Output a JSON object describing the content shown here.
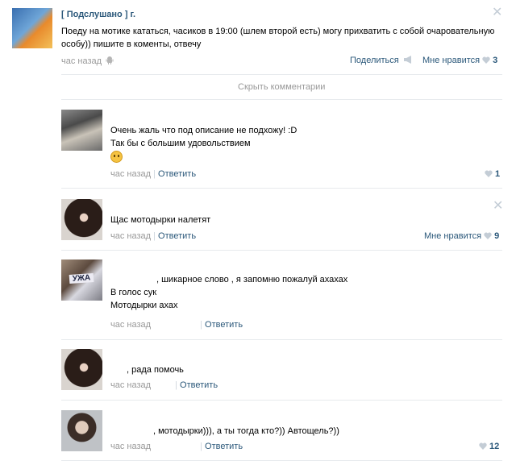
{
  "post": {
    "author": "[ Подслушано ] г.",
    "text": "Поеду на мотике кататься, часиков в 19:00 (шлем второй есть) могу прихватить с собой очаровательную особу)) пишите в коменты, отвечу",
    "time": "час назад",
    "share_label": "Поделиться",
    "like_label": "Мне нравится",
    "like_count": "3"
  },
  "hide_comments_label": "Скрыть комментарии",
  "comments": [
    {
      "lines": [
        "Очень жаль что под описание не подхожу! :D",
        "Так бы с большим удовольствием"
      ],
      "time": "час назад",
      "reply_label": "Ответить",
      "like_count": "1"
    },
    {
      "lines": [
        "Щас мотодырки налетят"
      ],
      "time": "час назад",
      "reply_label": "Ответить",
      "like_label": "Мне нравится",
      "like_count": "9"
    },
    {
      "lines": [
        ", шикарное слово , я запомню пожалуй ахахах",
        "В голос сук",
        "Мотодырки ахах"
      ],
      "avatar_text": "УЖА",
      "time": "час назад",
      "reply_label": "Ответить"
    },
    {
      "lines": [
        ", рада помочь"
      ],
      "time": "час назад",
      "reply_label": "Ответить"
    },
    {
      "lines": [
        ", мотодырки))), а ты тогда кто?)) Автощель?))"
      ],
      "time": "час назад",
      "reply_label": "Ответить",
      "like_count": "12"
    }
  ],
  "colors": {
    "link": "#2b587a",
    "muted": "#999999",
    "heart": "#c4cdd6",
    "divider": "#e7eaed"
  }
}
